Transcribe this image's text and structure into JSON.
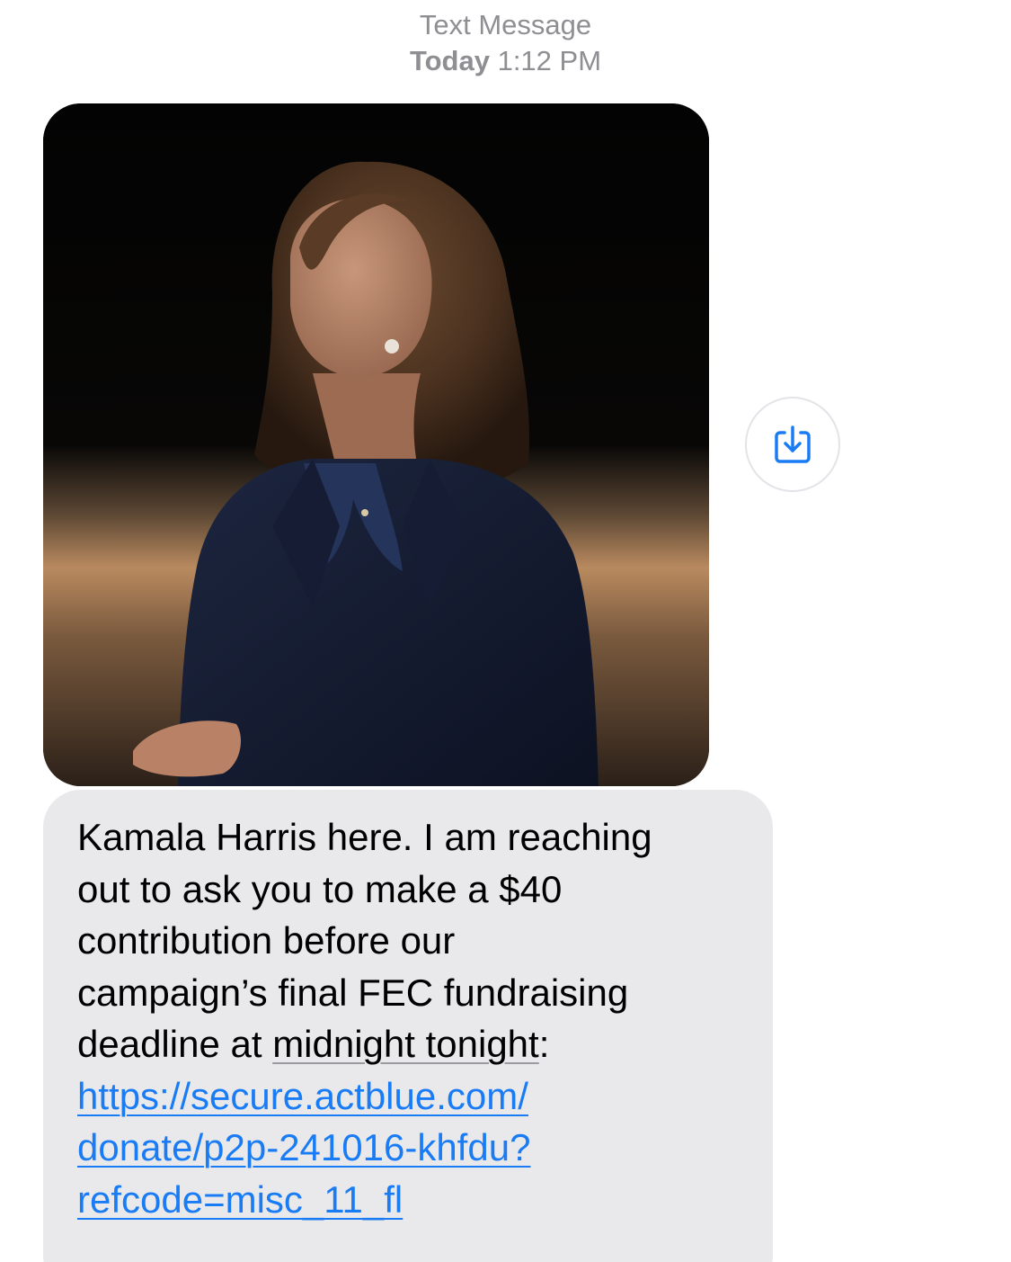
{
  "header": {
    "service": "Text Message",
    "day": "Today",
    "time": "1:12 PM"
  },
  "message": {
    "image_alt": "Kamala Harris portrait",
    "text_lines": [
      "Kamala Harris here. I am reaching",
      "out to ask you to make a $40",
      "contribution before our",
      "campaign’s final FEC fundraising"
    ],
    "deadline_prefix": "deadline at ",
    "deadline_phrase": "midnight tonight",
    "deadline_suffix": ":",
    "link_lines": [
      "https://secure.actblue.com/",
      "donate/p2p-241016-khfdu?",
      "refcode=misc_11_fl"
    ]
  },
  "actions": {
    "save_icon": "save-to-photos-icon"
  },
  "colors": {
    "bubble": "#e9e9eb",
    "link": "#1a7cf5",
    "meta_text": "#8e8e93"
  }
}
